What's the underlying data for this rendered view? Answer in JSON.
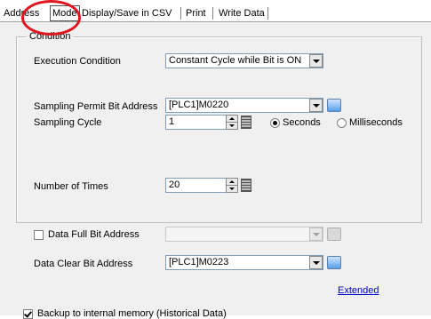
{
  "tabs": [
    {
      "label": "Address"
    },
    {
      "label": "Mode"
    },
    {
      "label": "Display/Save in CSV"
    },
    {
      "label": "Print"
    },
    {
      "label": "Write Data"
    }
  ],
  "active_tab": "Mode",
  "condition_group": {
    "title": "Condition",
    "execution_condition": {
      "label": "Execution Condition",
      "value": "Constant Cycle while Bit is ON"
    },
    "sampling_permit": {
      "label": "Sampling Permit Bit Address",
      "value": "[PLC1]M0220"
    },
    "sampling_cycle": {
      "label": "Sampling Cycle",
      "value": "1",
      "unit_seconds": "Seconds",
      "unit_milliseconds": "Milliseconds",
      "selected_unit": "Seconds"
    },
    "number_of_times": {
      "label": "Number of Times",
      "value": "20"
    }
  },
  "data_full": {
    "label": "Data Full Bit Address",
    "checked": false,
    "value": ""
  },
  "data_clear": {
    "label": "Data Clear Bit Address",
    "value": "[PLC1]M0223"
  },
  "extended_link": "Extended",
  "bottom_checkbox": {
    "label": "Backup to internal memory (Historical Data)",
    "checked": true
  },
  "colors": {
    "highlight": "#e0141e",
    "link": "#0000cc",
    "dialog_bg": "#f0f0f0"
  }
}
